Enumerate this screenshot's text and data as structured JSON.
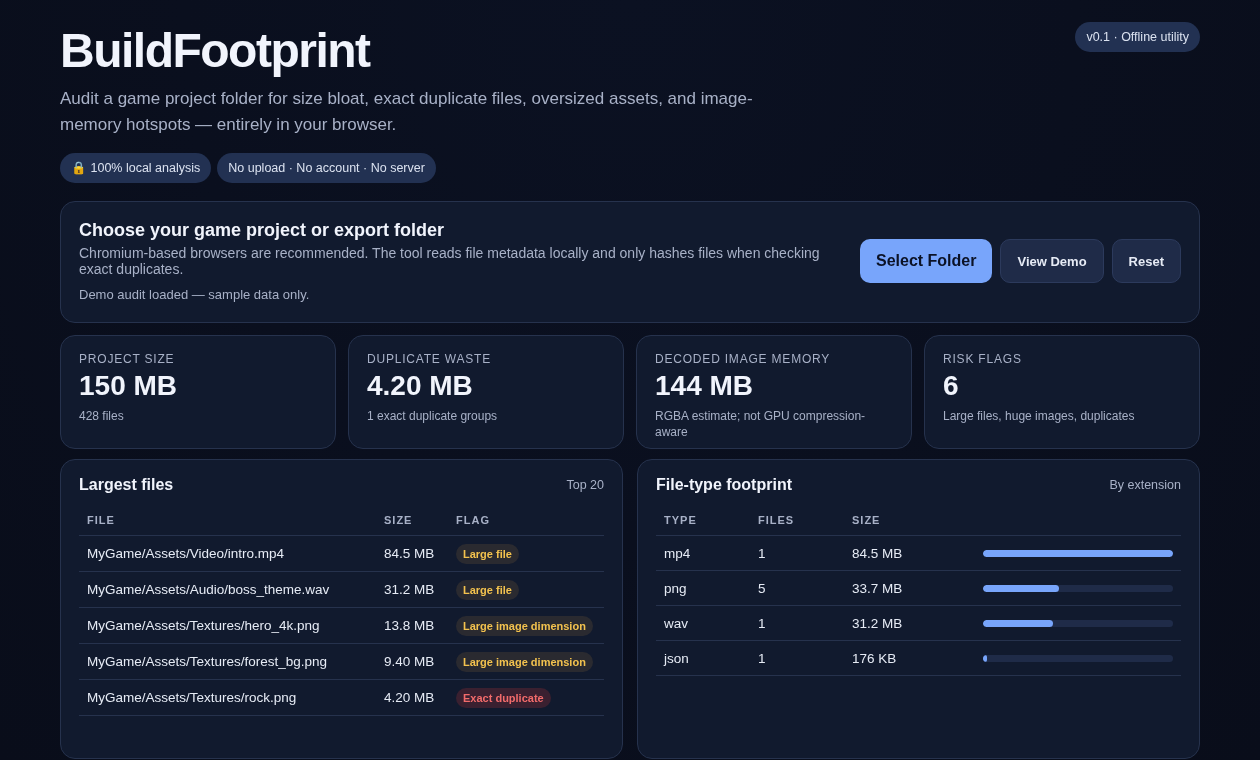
{
  "header": {
    "title": "BuildFootprint",
    "subtitle": "Audit a game project folder for size bloat, exact duplicate files, oversized assets, and image-memory hotspots — entirely in your browser.",
    "version_badge": "v0.1 · Offline utility",
    "chips": [
      "🔒 100% local analysis",
      "No upload · No account · No server"
    ]
  },
  "chooser": {
    "title": "Choose your game project or export folder",
    "description": "Chromium-based browsers are recommended. The tool reads file metadata locally and only hashes files when checking exact duplicates.",
    "status": "Demo audit loaded — sample data only.",
    "buttons": [
      {
        "label": "Select Folder",
        "kind": "primary"
      },
      {
        "label": "View Demo",
        "kind": "secondary"
      },
      {
        "label": "Reset",
        "kind": "secondary"
      }
    ]
  },
  "stats": [
    {
      "label": "PROJECT SIZE",
      "value": "150 MB",
      "note": "428 files"
    },
    {
      "label": "DUPLICATE WASTE",
      "value": "4.20 MB",
      "note": "1 exact duplicate groups"
    },
    {
      "label": "DECODED IMAGE MEMORY",
      "value": "144 MB",
      "note": "RGBA estimate; not GPU compression-aware"
    },
    {
      "label": "RISK FLAGS",
      "value": "6",
      "note": "Large files, huge images, duplicates"
    }
  ],
  "largest_files": {
    "title": "Largest files",
    "meta": "Top 20",
    "columns": [
      "FILE",
      "SIZE",
      "FLAG"
    ],
    "rows": [
      {
        "file": "MyGame/Assets/Video/intro.mp4",
        "size": "84.5 MB",
        "flag": "Large file",
        "kind": "warn"
      },
      {
        "file": "MyGame/Assets/Audio/boss_theme.wav",
        "size": "31.2 MB",
        "flag": "Large file",
        "kind": "warn"
      },
      {
        "file": "MyGame/Assets/Textures/hero_4k.png",
        "size": "13.8 MB",
        "flag": "Large image dimension",
        "kind": "warn"
      },
      {
        "file": "MyGame/Assets/Textures/forest_bg.png",
        "size": "9.40 MB",
        "flag": "Large image dimension",
        "kind": "warn"
      },
      {
        "file": "MyGame/Assets/Textures/rock.png",
        "size": "4.20 MB",
        "flag": "Exact duplicate",
        "kind": "danger"
      }
    ]
  },
  "file_types": {
    "title": "File-type footprint",
    "meta": "By extension",
    "columns": [
      "TYPE",
      "FILES",
      "SIZE"
    ],
    "rows": [
      {
        "type": "mp4",
        "files": "1",
        "size": "84.5 MB",
        "level": 1
      },
      {
        "type": "png",
        "files": "5",
        "size": "33.7 MB",
        "level": 0.4
      },
      {
        "type": "wav",
        "files": "1",
        "size": "31.2 MB",
        "level": 0.37
      },
      {
        "type": "json",
        "files": "1",
        "size": "176 KB",
        "level": 0.02
      }
    ]
  }
}
